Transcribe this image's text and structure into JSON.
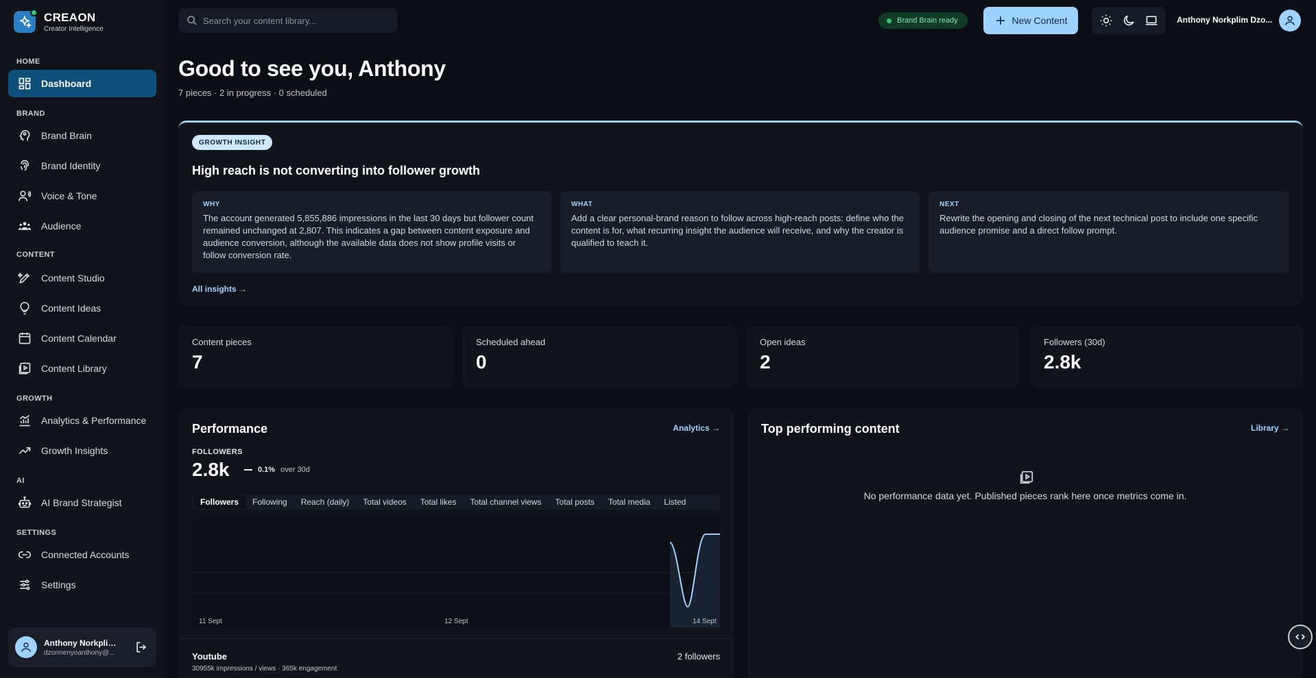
{
  "brand": {
    "name": "CREAON",
    "tagline": "Creator Intelligence"
  },
  "sidebar": {
    "sections": {
      "home": "HOME",
      "brand": "BRAND",
      "content": "CONTENT",
      "growth": "GROWTH",
      "ai": "AI",
      "settings": "SETTINGS"
    },
    "items": [
      {
        "label": "Dashboard"
      },
      {
        "label": "Brand Brain"
      },
      {
        "label": "Brand Identity"
      },
      {
        "label": "Voice & Tone"
      },
      {
        "label": "Audience"
      },
      {
        "label": "Content Studio"
      },
      {
        "label": "Content Ideas"
      },
      {
        "label": "Content Calendar"
      },
      {
        "label": "Content Library"
      },
      {
        "label": "Analytics & Performance"
      },
      {
        "label": "Growth Insights"
      },
      {
        "label": "AI Brand Strategist"
      },
      {
        "label": "Connected Accounts"
      },
      {
        "label": "Settings"
      }
    ],
    "user": {
      "name": "Anthony Norkplim Dzo...",
      "email": "dzormenyoanthony@..."
    }
  },
  "topbar": {
    "search_placeholder": "Search your content library...",
    "status": "Brand Brain ready",
    "new_button": "New Content",
    "user_name": "Anthony Norkplim Dzo..."
  },
  "page": {
    "greeting": "Good to see you, Anthony",
    "summary": "7 pieces · 2 in progress · 0 scheduled"
  },
  "insight": {
    "badge": "GROWTH INSIGHT",
    "title": "High reach is not converting into follower growth",
    "why_label": "WHY",
    "why": "The account generated 5,855,886 impressions in the last 30 days but follower count remained unchanged at 2,807. This indicates a gap between content exposure and audience conversion, although the available data does not show profile visits or follow conversion rate.",
    "what_label": "WHAT",
    "what": "Add a clear personal-brand reason to follow across high-reach posts: define who the content is for, what recurring insight the audience will receive, and why the creator is qualified to teach it.",
    "next_label": "NEXT",
    "next": "Rewrite the opening and closing of the next technical post to include one specific audience promise and a direct follow prompt.",
    "link": "All insights →"
  },
  "stats": [
    {
      "label": "Content pieces",
      "value": "7"
    },
    {
      "label": "Scheduled ahead",
      "value": "0"
    },
    {
      "label": "Open ideas",
      "value": "2"
    },
    {
      "label": "Followers (30d)",
      "value": "2.8k"
    }
  ],
  "performance": {
    "title": "Performance",
    "link": "Analytics →",
    "metric_label": "FOLLOWERS",
    "metric_value": "2.8k",
    "delta": "0.1%",
    "delta_period": "over 30d",
    "tabs": [
      "Followers",
      "Following",
      "Reach (daily)",
      "Total videos",
      "Total likes",
      "Total channel views",
      "Total posts",
      "Total media",
      "Listed"
    ],
    "channel": {
      "name": "Youtube",
      "detail": "30955k impressions / views · 365k engagement",
      "count": "2 followers"
    }
  },
  "chart_data": {
    "type": "area",
    "x": [
      "11 Sept",
      "12 Sept",
      "14 Sept"
    ],
    "series": [
      {
        "values": [
          0,
          0,
          1
        ]
      }
    ],
    "grid": true,
    "legend": "none",
    "color": "#9fd3ff"
  },
  "top_content": {
    "title": "Top performing content",
    "link": "Library →",
    "empty": "No performance data yet. Published pieces rank here once metrics come in."
  },
  "colors": {
    "accent": "#9fd3ff",
    "active_nav": "#0f4f7c",
    "ready": "#2ecc71"
  }
}
